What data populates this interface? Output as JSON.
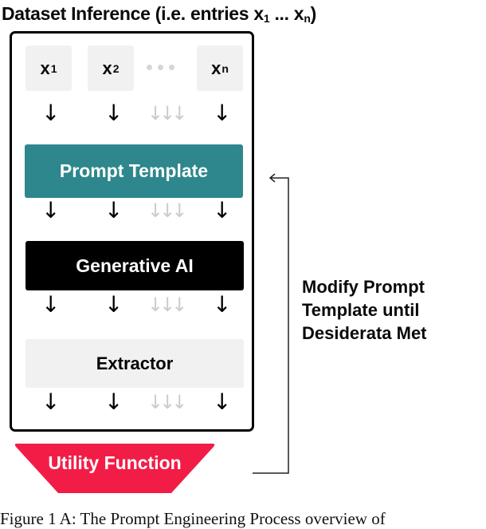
{
  "title": {
    "prefix": "Dataset Inference (i.e. entries x",
    "sub_first": "1",
    "middle": " ... x",
    "sub_last": "n",
    "suffix": ")"
  },
  "entries": [
    {
      "label": "x",
      "sub": "1"
    },
    {
      "label": "x",
      "sub": "2"
    },
    {
      "label": "x",
      "sub": "n"
    }
  ],
  "ellipsis_icon": "three-dots",
  "arrow_glyph": "↓",
  "faint_arrow_glyph": "↓↓↓",
  "stages": {
    "prompt_template": "Prompt Template",
    "generative_ai": "Generative AI",
    "extractor": "Extractor",
    "utility_function": "Utility Function"
  },
  "feedback": {
    "lines": [
      "Modify Prompt",
      "Template until",
      "Desiderata Met"
    ],
    "arrow_glyph": "←"
  },
  "caption": "Figure 1 A: The Prompt Engineering Process overview of",
  "colors": {
    "prompt_template": "#2e878d",
    "generative_ai": "#000000",
    "extractor": "#f1f1f1",
    "utility_function": "#f21d47",
    "entry_box": "#f1f1f1",
    "faint_arrow": "#cccccc"
  }
}
